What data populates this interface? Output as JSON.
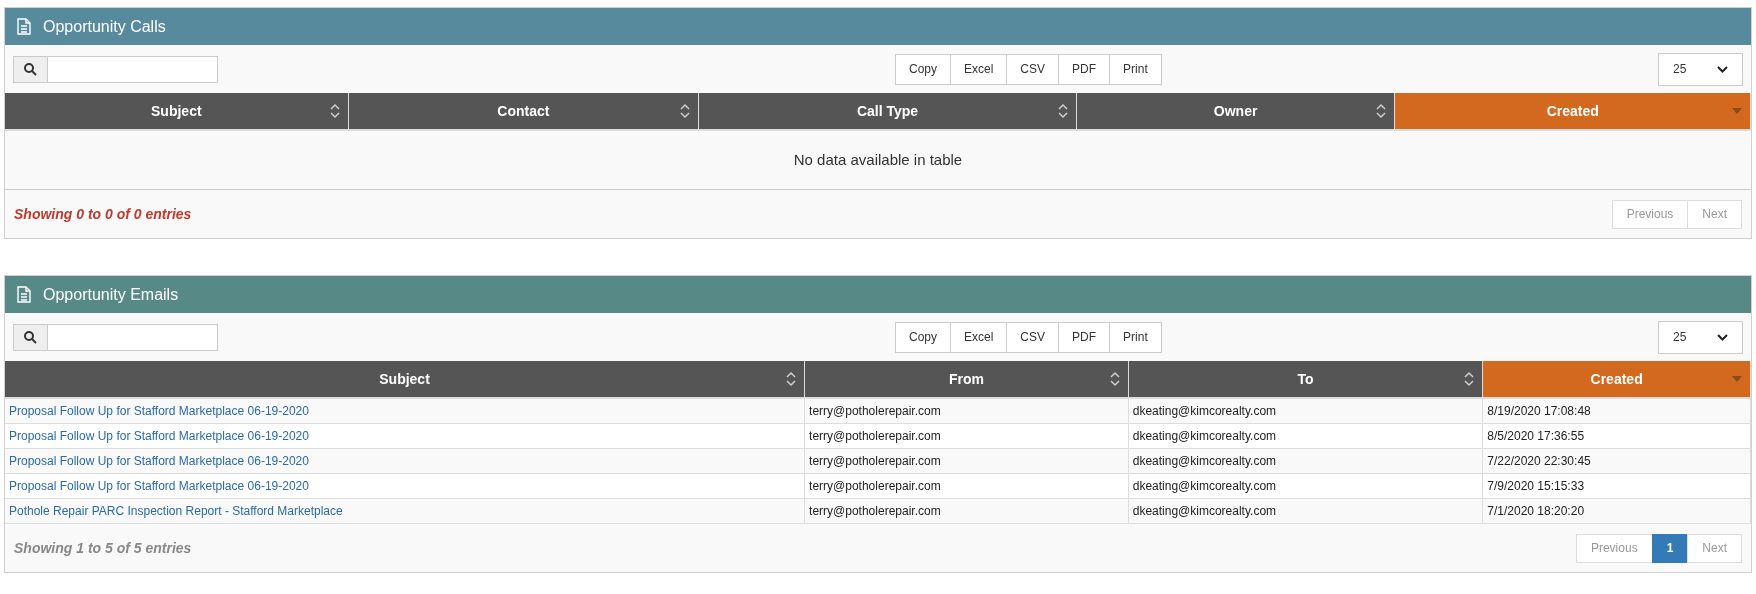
{
  "panels": [
    {
      "title": "Opportunity Calls",
      "color": "#578a9d",
      "export_buttons": [
        "Copy",
        "Excel",
        "CSV",
        "PDF",
        "Print"
      ],
      "page_size": "25",
      "columns": [
        {
          "label": "Subject",
          "sorted": false
        },
        {
          "label": "Contact",
          "sorted": false
        },
        {
          "label": "Call Type",
          "sorted": false
        },
        {
          "label": "Owner",
          "sorted": false
        },
        {
          "label": "Created",
          "sorted": true
        }
      ],
      "empty_message": "No data available in table",
      "info": "Showing 0 to 0 of 0 entries",
      "alert": true,
      "pagination": [
        {
          "label": "Previous",
          "kind": "nav",
          "disabled": true
        },
        {
          "label": "Next",
          "kind": "nav",
          "disabled": true
        }
      ]
    },
    {
      "title": "Opportunity Emails",
      "color": "#578a87",
      "export_buttons": [
        "Copy",
        "Excel",
        "CSV",
        "PDF",
        "Print"
      ],
      "page_size": "25",
      "columns": [
        {
          "label": "Subject",
          "sorted": false
        },
        {
          "label": "From",
          "sorted": false
        },
        {
          "label": "To",
          "sorted": false
        },
        {
          "label": "Created",
          "sorted": true
        }
      ],
      "rows": [
        [
          "Proposal Follow Up for Stafford Marketplace 06-19-2020",
          "terry@potholerepair.com",
          "dkeating@kimcorealty.com",
          "8/19/2020 17:08:48"
        ],
        [
          "Proposal Follow Up for Stafford Marketplace 06-19-2020",
          "terry@potholerepair.com",
          "dkeating@kimcorealty.com",
          "8/5/2020 17:36:55"
        ],
        [
          "Proposal Follow Up for Stafford Marketplace 06-19-2020",
          "terry@potholerepair.com",
          "dkeating@kimcorealty.com",
          "7/22/2020 22:30:45"
        ],
        [
          "Proposal Follow Up for Stafford Marketplace 06-19-2020",
          "terry@potholerepair.com",
          "dkeating@kimcorealty.com",
          "7/9/2020 15:15:33"
        ],
        [
          "Pothole Repair PARC Inspection Report - Stafford Marketplace",
          "terry@potholerepair.com",
          "dkeating@kimcorealty.com",
          "7/1/2020 18:20:20"
        ]
      ],
      "info": "Showing **1** to **5** of **5** entries",
      "alert": false,
      "pagination": [
        {
          "label": "Previous",
          "kind": "nav",
          "disabled": true
        },
        {
          "label": "1",
          "kind": "page",
          "selected": true
        },
        {
          "label": "Next",
          "kind": "nav",
          "disabled": true
        }
      ]
    }
  ]
}
